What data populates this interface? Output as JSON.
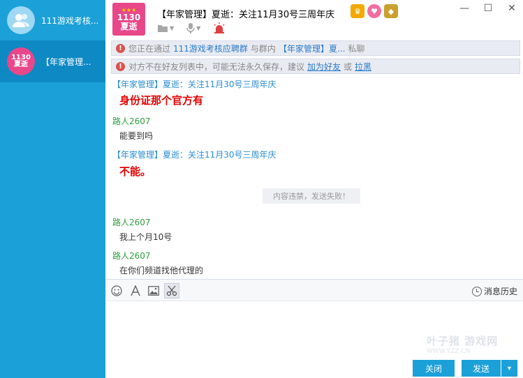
{
  "sidebar": {
    "items": [
      {
        "label": "111游戏考核..."
      },
      {
        "label": "【年家管理..."
      }
    ],
    "avatar_text": {
      "line1": "1130",
      "line2": "夏逝"
    }
  },
  "header": {
    "title": "【年家管理】夏逝：关注11月30号三周年庆",
    "logo_line1": "1130",
    "logo_line2": "夏逝"
  },
  "notices": {
    "n1": {
      "prefix": "您正在通过",
      "group": "111游戏考核应聘群",
      "middle": "与群内",
      "person": "【年家管理】夏...",
      "suffix": "私聊"
    },
    "n2": {
      "prefix": "对方不在好友列表中，可能无法永久保存，建议",
      "add_friend": "加为好友",
      "or": "或",
      "block": "拉黑"
    }
  },
  "messages": [
    {
      "sender": "【年家管理】夏逝：关注11月30号三周年庆",
      "text": "身份证那个官方有"
    },
    {
      "sender": "路人2607",
      "text": "能要到吗"
    },
    {
      "sender": "【年家管理】夏逝：关注11月30号三周年庆",
      "text": "不能。"
    },
    {
      "sender": "路人2607",
      "text": "我上个月10号"
    },
    {
      "sender": "路人2607",
      "text": "在你们频道找他代理的"
    }
  ],
  "system_tip": "内容违禁，发送失败！",
  "input_toolbar": {
    "history_label": "消息历史"
  },
  "watermark": {
    "main": "叶子猪 游戏网",
    "url": "WWW.YZZ.CN"
  },
  "buttons": {
    "close": "关闭",
    "send": "发送"
  },
  "colors": {
    "sidebar": "#1ba0d8",
    "accent": "#1ba0d8",
    "sender_blue": "#2b8ed1",
    "sender_green": "#2f9e3e",
    "emphasis_red": "#e60000"
  }
}
